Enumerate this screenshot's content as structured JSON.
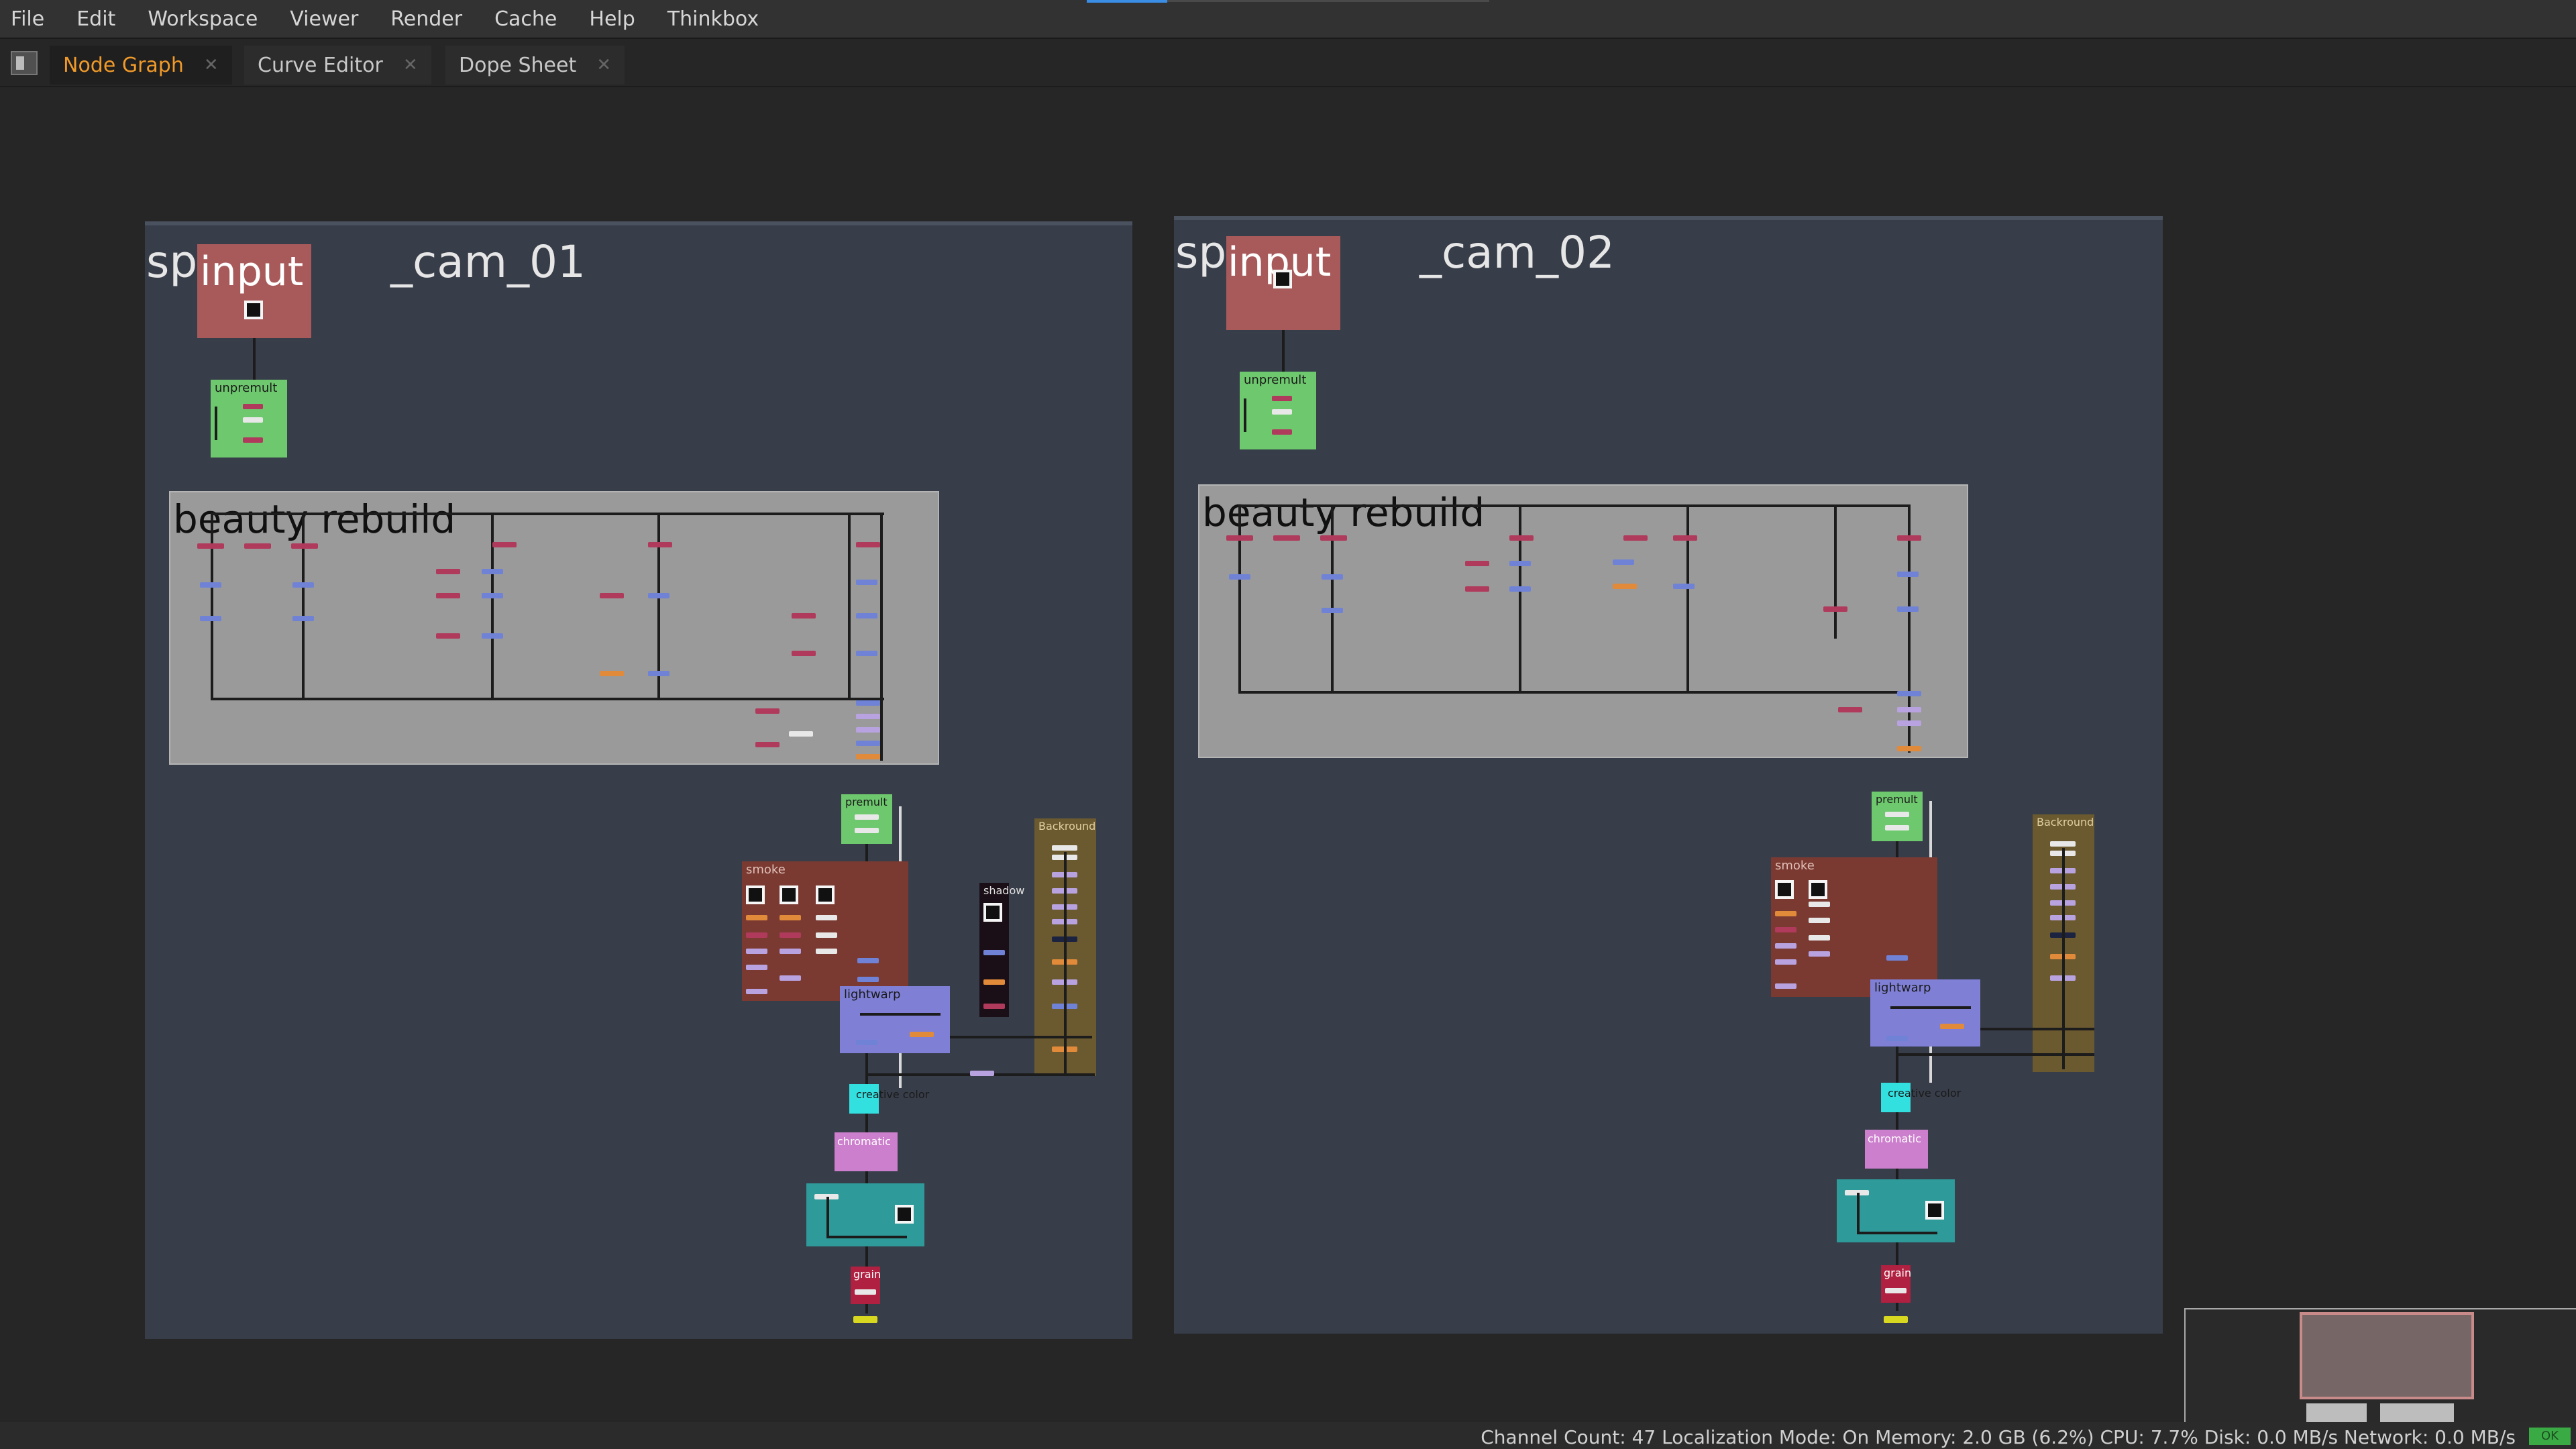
{
  "menu": [
    "File",
    "Edit",
    "Workspace",
    "Viewer",
    "Render",
    "Cache",
    "Help",
    "Thinkbox"
  ],
  "tabs": [
    {
      "label": "Node Graph",
      "active": true
    },
    {
      "label": "Curve Editor",
      "active": false
    },
    {
      "label": "Dope Sheet",
      "active": false
    }
  ],
  "icons": {
    "close": "close-icon",
    "panel": "panel-toggle-icon"
  },
  "graph": {
    "left": {
      "title": "sp_cam_01",
      "title_left": "sp",
      "title_right": "_cam_01",
      "subgroup": "beauty rebuild",
      "nodes": {
        "input": "input",
        "unpremult": "unpremult",
        "premult": "premult",
        "smoke": "smoke",
        "shadow": "shadow",
        "backround": "Backround",
        "lightwarp": "lightwarp",
        "creative_color": "creative color",
        "chromatic": "chromatic",
        "grain": "grain"
      }
    },
    "right": {
      "title": "sp_cam_02",
      "title_left": "sp",
      "title_right": "_cam_02",
      "subgroup": "beauty rebuild",
      "nodes": {
        "input": "input",
        "unpremult": "unpremult",
        "premult": "premult",
        "smoke": "smoke",
        "backround": "Backround",
        "lightwarp": "lightwarp",
        "creative_color": "creative color",
        "chromatic": "chromatic",
        "grain": "grain"
      }
    }
  },
  "colors": {
    "accent": "#f09a2a",
    "backdrop": "#373d49",
    "input_node": "#a85a5a",
    "unpremult": "#6ec86e",
    "smoke": "#7a3a32",
    "lightwarp": "#7f7fd6",
    "creative_color": "#33e0e0",
    "chromatic": "#cc7fcc",
    "grade": "#2f9a9a",
    "grain": "#b02040",
    "status_ok": "#3aaa45"
  },
  "status": {
    "text": "Channel Count: 47  Localization Mode: On  Memory: 2.0 GB (6.2%)  CPU: 7.7%  Disk: 0.0 MB/s  Network: 0.0 MB/s",
    "badge": "OK"
  }
}
